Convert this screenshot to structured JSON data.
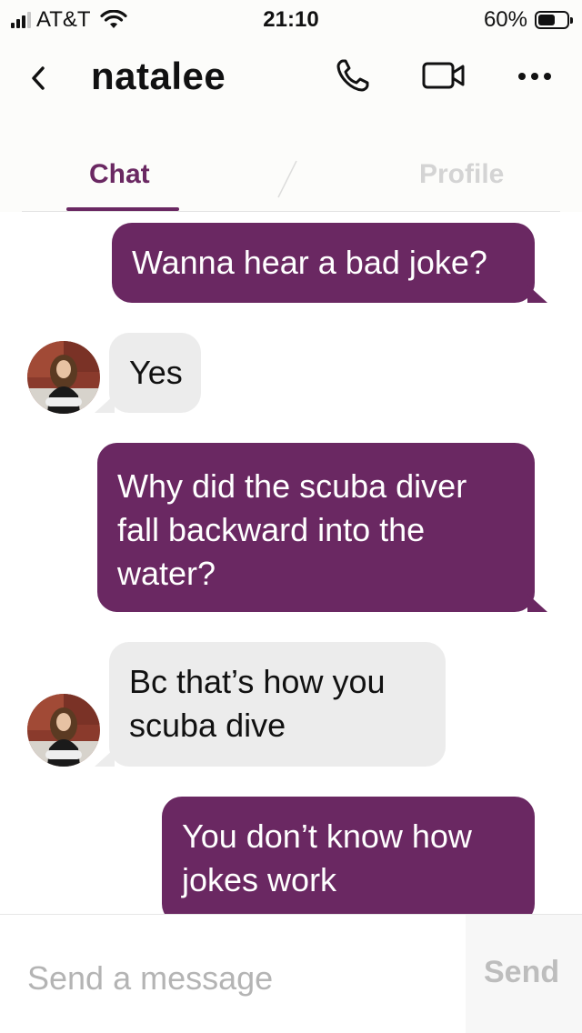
{
  "status_bar": {
    "carrier": "AT&T",
    "time": "21:10",
    "battery_percent": "60%",
    "battery_level": 0.6,
    "signal_bars": 3,
    "signal_bars_max": 4
  },
  "header": {
    "contact_name": "natalee",
    "icons": [
      "chevron-left-icon",
      "phone-icon",
      "video-icon",
      "more-icon"
    ]
  },
  "tabs": [
    {
      "label": "Chat",
      "active": true
    },
    {
      "label": "Profile",
      "active": false
    }
  ],
  "messages": [
    {
      "sender": "me",
      "text": "Wanna hear a bad joke?"
    },
    {
      "sender": "natalee",
      "text": "Yes"
    },
    {
      "sender": "me",
      "text": "Why did the scuba diver fall backward into the water?"
    },
    {
      "sender": "natalee",
      "text": "Bc that’s how you scuba dive"
    },
    {
      "sender": "me",
      "text": "You don’t know how jokes work"
    }
  ],
  "composer": {
    "placeholder": "Send a message",
    "send_label": "Send"
  },
  "colors": {
    "accent": "#6a2862",
    "incoming_bubble": "#ececec",
    "inactive_tab": "#d4d4d4"
  }
}
